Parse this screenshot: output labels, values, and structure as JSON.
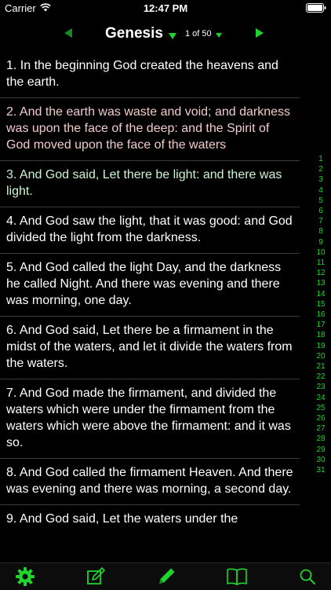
{
  "status_bar": {
    "carrier": "Carrier",
    "time": "12:47 PM"
  },
  "header": {
    "book": "Genesis",
    "chapter": "1 of 50"
  },
  "verses": [
    {
      "text": "1. In the beginning God created the heavens and the earth.",
      "color": "#ffffff"
    },
    {
      "text": "2. And the earth was waste and void; and darkness was upon the face of the deep: and the Spirit of God moved upon the face of the waters",
      "color": "#f3c9cc"
    },
    {
      "text": "3. And God said, Let there be light: and there was light.",
      "color": "#cdf5d4"
    },
    {
      "text": "4. And God saw the light, that it was good: and God divided the light from the darkness.",
      "color": "#ffffff"
    },
    {
      "text": "5. And God called the light Day, and the darkness he called Night. And there was evening and there was morning, one day.",
      "color": "#ffffff"
    },
    {
      "text": "6. And God said, Let there be a firmament in the midst of the waters, and let it divide the waters from the waters.",
      "color": "#ffffff"
    },
    {
      "text": "7. And God made the firmament, and divided the waters which were under the firmament from the waters which were above the firmament: and it was so.",
      "color": "#ffffff"
    },
    {
      "text": "8. And God called the firmament Heaven. And there was evening and there was morning, a second day.",
      "color": "#ffffff"
    },
    {
      "text": "9. And God said, Let the waters under the",
      "color": "#ffffff"
    }
  ],
  "verse_index": [
    "1",
    "2",
    "3",
    "4",
    "5",
    "6",
    "7",
    "8",
    "9",
    "10",
    "11",
    "12",
    "13",
    "14",
    "15",
    "16",
    "17",
    "18",
    "19",
    "20",
    "21",
    "22",
    "23",
    "24",
    "25",
    "26",
    "27",
    "28",
    "29",
    "30",
    "31"
  ],
  "tabs": [
    {
      "icon": "gear-icon"
    },
    {
      "icon": "compose-icon"
    },
    {
      "icon": "pencil-icon"
    },
    {
      "icon": "book-icon"
    },
    {
      "icon": "search-icon"
    }
  ],
  "colors": {
    "accent": "#1fd42c",
    "background": "#000000"
  }
}
